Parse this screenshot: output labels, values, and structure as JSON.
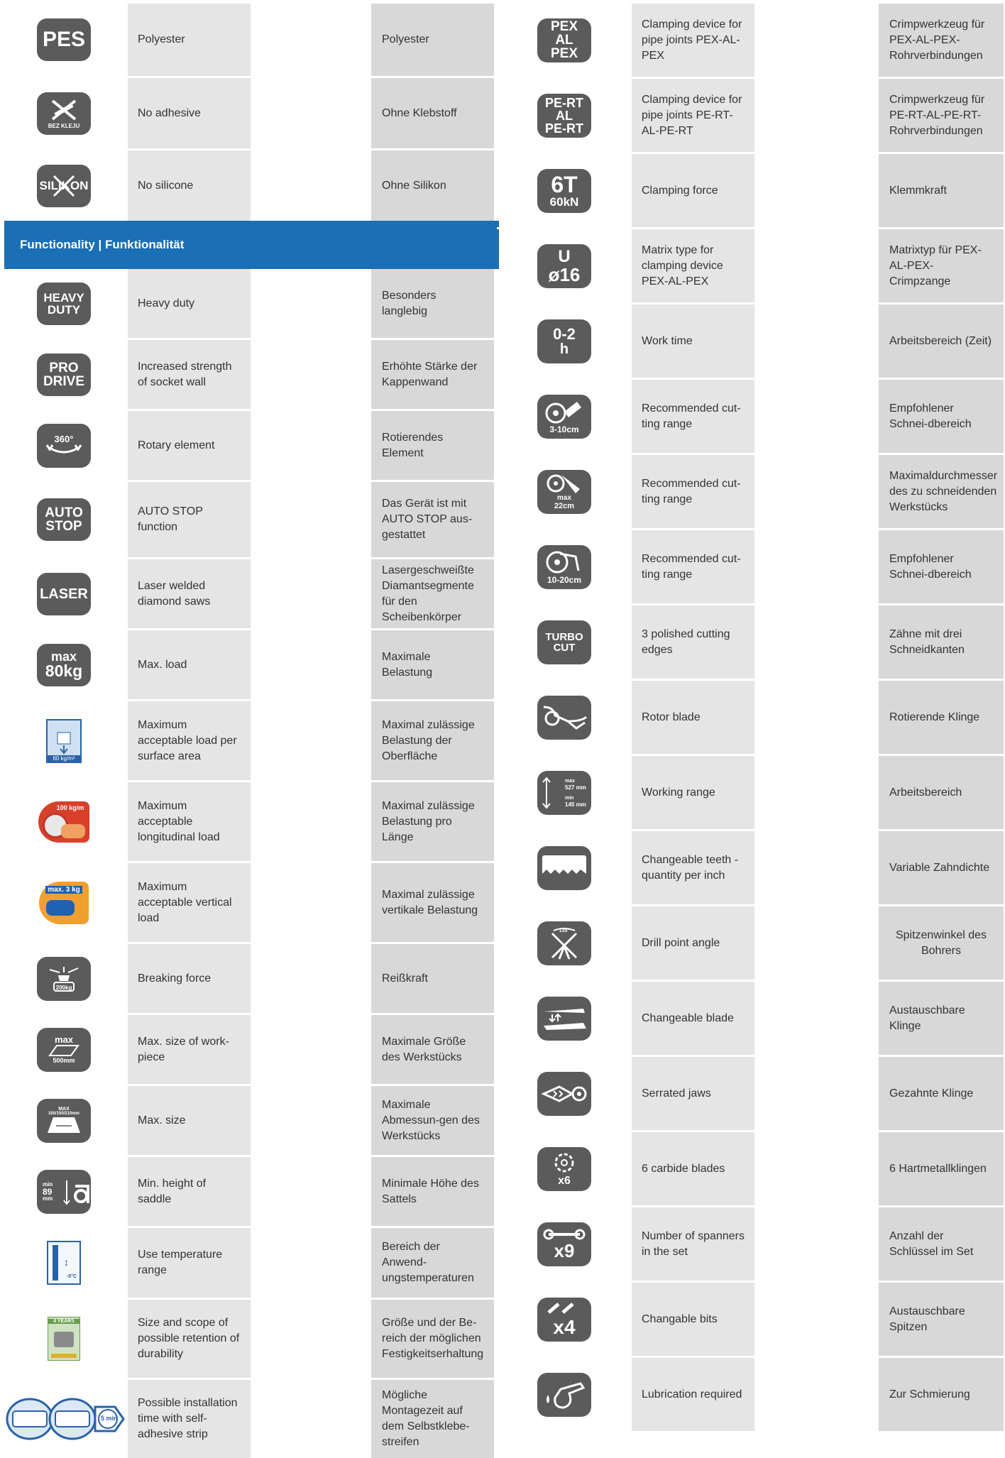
{
  "left": {
    "rows_top": [
      {
        "icon": "pes-icon",
        "badge": "PES",
        "en": "Polyester",
        "de": "Polyester"
      },
      {
        "icon": "no-adhesive-icon",
        "badge": "BEZ KLEJU",
        "en": "No adhesive",
        "de": "Ohne Klebstoff"
      },
      {
        "icon": "no-silicone-icon",
        "badge": "SILIKON",
        "en": "No silicone",
        "de": "Ohne Silikon"
      }
    ],
    "section_title": "Functionality | Funktionalität",
    "rows": [
      {
        "icon": "heavy-duty-icon",
        "badge": [
          "HEAVY",
          "DUTY"
        ],
        "en": "Heavy duty",
        "de": "Besonders langlebig"
      },
      {
        "icon": "pro-drive-icon",
        "badge": [
          "PRO",
          "DRIVE"
        ],
        "en": "Increased strength of socket wall",
        "de": "Erhöhte Stärke der Kappenwand"
      },
      {
        "icon": "rotary-360-icon",
        "badge": "360°",
        "en": "Rotary element",
        "de": "Rotierendes Element"
      },
      {
        "icon": "auto-stop-icon",
        "badge": [
          "AUTO",
          "STOP"
        ],
        "en": "AUTO STOP function",
        "de": "Das Gerät ist mit AUTO STOP aus-gestattet"
      },
      {
        "icon": "laser-icon",
        "badge": "LASER",
        "en": "Laser welded diamond saws",
        "de": "Lasergeschweißte Diamantsegmente für den Scheibenkörper"
      },
      {
        "icon": "max-80kg-icon",
        "badge": [
          "max",
          "80kg"
        ],
        "en": "Max. load",
        "de": "Maximale Belastung"
      },
      {
        "icon": "surface-load-icon",
        "badge": "60 kg/m²",
        "en": "Maximum acceptable load per surface area",
        "de": "Maximal zulässige Belastung der Oberfläche"
      },
      {
        "icon": "longitudinal-load-icon",
        "badge": "100 kg/m",
        "en": "Maximum acceptable longitudinal load",
        "de": "Maximal zulässige Belastung pro Länge"
      },
      {
        "icon": "vertical-load-icon",
        "badge": "max. 3 kg",
        "en": "Maximum acceptable vertical load",
        "de": "Maximal zulässige vertikale Belastung"
      },
      {
        "icon": "breaking-force-icon",
        "badge": "200kg",
        "en": "Breaking force",
        "de": "Reißkraft"
      },
      {
        "icon": "max-workpiece-icon",
        "badge": [
          "max",
          "500mm"
        ],
        "en": "Max. size of work-piece",
        "de": "Maximale Größe des Werkstücks"
      },
      {
        "icon": "max-size-icon",
        "badge": [
          "MAX",
          "100/150/210mm"
        ],
        "en": "Max. size",
        "de": "Maximale Abmessun-gen des Werkstücks"
      },
      {
        "icon": "saddle-height-icon",
        "badge": [
          "min",
          "89",
          "mm"
        ],
        "en": "Min. height of saddle",
        "de": "Minimale Höhe des Sattels"
      },
      {
        "icon": "temperature-range-icon",
        "badge": "-5°C",
        "en": "Use temperature range",
        "de": "Bereich der Anwend-ungstemperaturen"
      },
      {
        "icon": "durability-icon",
        "badge": "4 YEARS",
        "en": "Size and scope of possible retention of durability",
        "de": "Größe und der Be-reich der möglichen Festigkeitserhaltung"
      },
      {
        "icon": "installation-time-icon",
        "badge": "5 min",
        "en": "Possible installation time with self-adhesive strip",
        "de": "Mögliche Montagezeit auf dem Selbstklebe-streifen"
      }
    ]
  },
  "right": {
    "rows": [
      {
        "icon": "pex-al-pex-icon",
        "badge": [
          "PEX",
          "AL",
          "PEX"
        ],
        "en": "Clamping device for pipe joints PEX-AL-PEX",
        "de": "Crimpwerkzeug für PEX-AL-PEX-Rohrverbindungen"
      },
      {
        "icon": "pe-rt-al-pe-rt-icon",
        "badge": [
          "PE-RT",
          "AL",
          "PE-RT"
        ],
        "en": "Clamping device for pipe joints PE-RT-AL-PE-RT",
        "de": "Crimpwerkzeug für PE-RT-AL-PE-RT-Rohrverbindungen"
      },
      {
        "icon": "clamping-force-icon",
        "badge": [
          "6T",
          "60kN"
        ],
        "en": "Clamping force",
        "de": "Klemmkraft"
      },
      {
        "icon": "matrix-type-icon",
        "badge": [
          "U",
          "ø16"
        ],
        "en": "Matrix type for clamping device PEX-AL-PEX",
        "de": "Matrixtyp für PEX-AL-PEX-Crimpzange"
      },
      {
        "icon": "work-time-icon",
        "badge": [
          "0-2",
          "h"
        ],
        "en": "Work time",
        "de": "Arbeitsbereich (Zeit)"
      },
      {
        "icon": "cutting-range-3-10-icon",
        "badge": "3-10cm",
        "en": "Recommended cut-ting range",
        "de": "Empfohlener Schnei-dbereich"
      },
      {
        "icon": "cutting-max-22-icon",
        "badge": [
          "max",
          "22cm"
        ],
        "en": "Recommended cut-ting range",
        "de": "Maximaldurchmesser des zu schneidenden Werkstücks"
      },
      {
        "icon": "cutting-range-10-20-icon",
        "badge": "10-20cm",
        "en": "Recommended cut-ting range",
        "de": "Empfohlener Schnei-dbereich"
      },
      {
        "icon": "turbo-cut-icon",
        "badge": [
          "TURBO",
          "CUT"
        ],
        "en": "3 polished cutting edges",
        "de": "Zähne mit drei Schneidkanten"
      },
      {
        "icon": "rotor-blade-icon",
        "badge": "",
        "en": "Rotor blade",
        "de": "Rotierende Klinge"
      },
      {
        "icon": "working-range-icon",
        "badge": [
          "max",
          "527 mm",
          "min",
          "145 mm"
        ],
        "en": "Working range",
        "de": "Arbeitsbereich"
      },
      {
        "icon": "changeable-teeth-icon",
        "badge": "",
        "en": "Changeable teeth - quantity per inch",
        "de": "Variable Zahndichte"
      },
      {
        "icon": "drill-point-angle-icon",
        "badge": "135°",
        "en": "Drill point angle",
        "de": "Spitzenwinkel des Bohrers"
      },
      {
        "icon": "changeable-blade-icon",
        "badge": "",
        "en": "Changeable blade",
        "de": "Austauschbare Klinge"
      },
      {
        "icon": "serrated-jaws-icon",
        "badge": "",
        "en": "Serrated jaws",
        "de": "Gezahnte Klinge"
      },
      {
        "icon": "carbide-blades-icon",
        "badge": "x6",
        "en": "6 carbide blades",
        "de": "6 Hartmetallklingen"
      },
      {
        "icon": "spanners-icon",
        "badge": "x9",
        "en": "Number of spanners in the set",
        "de": "Anzahl der Schlüssel im Set"
      },
      {
        "icon": "changeable-bits-icon",
        "badge": "x4",
        "en": "Changable bits",
        "de": "Austauschbare Spitzen"
      },
      {
        "icon": "lubrication-icon",
        "badge": "",
        "en": "Lubrication required",
        "de": "Zur Schmierung"
      }
    ]
  }
}
